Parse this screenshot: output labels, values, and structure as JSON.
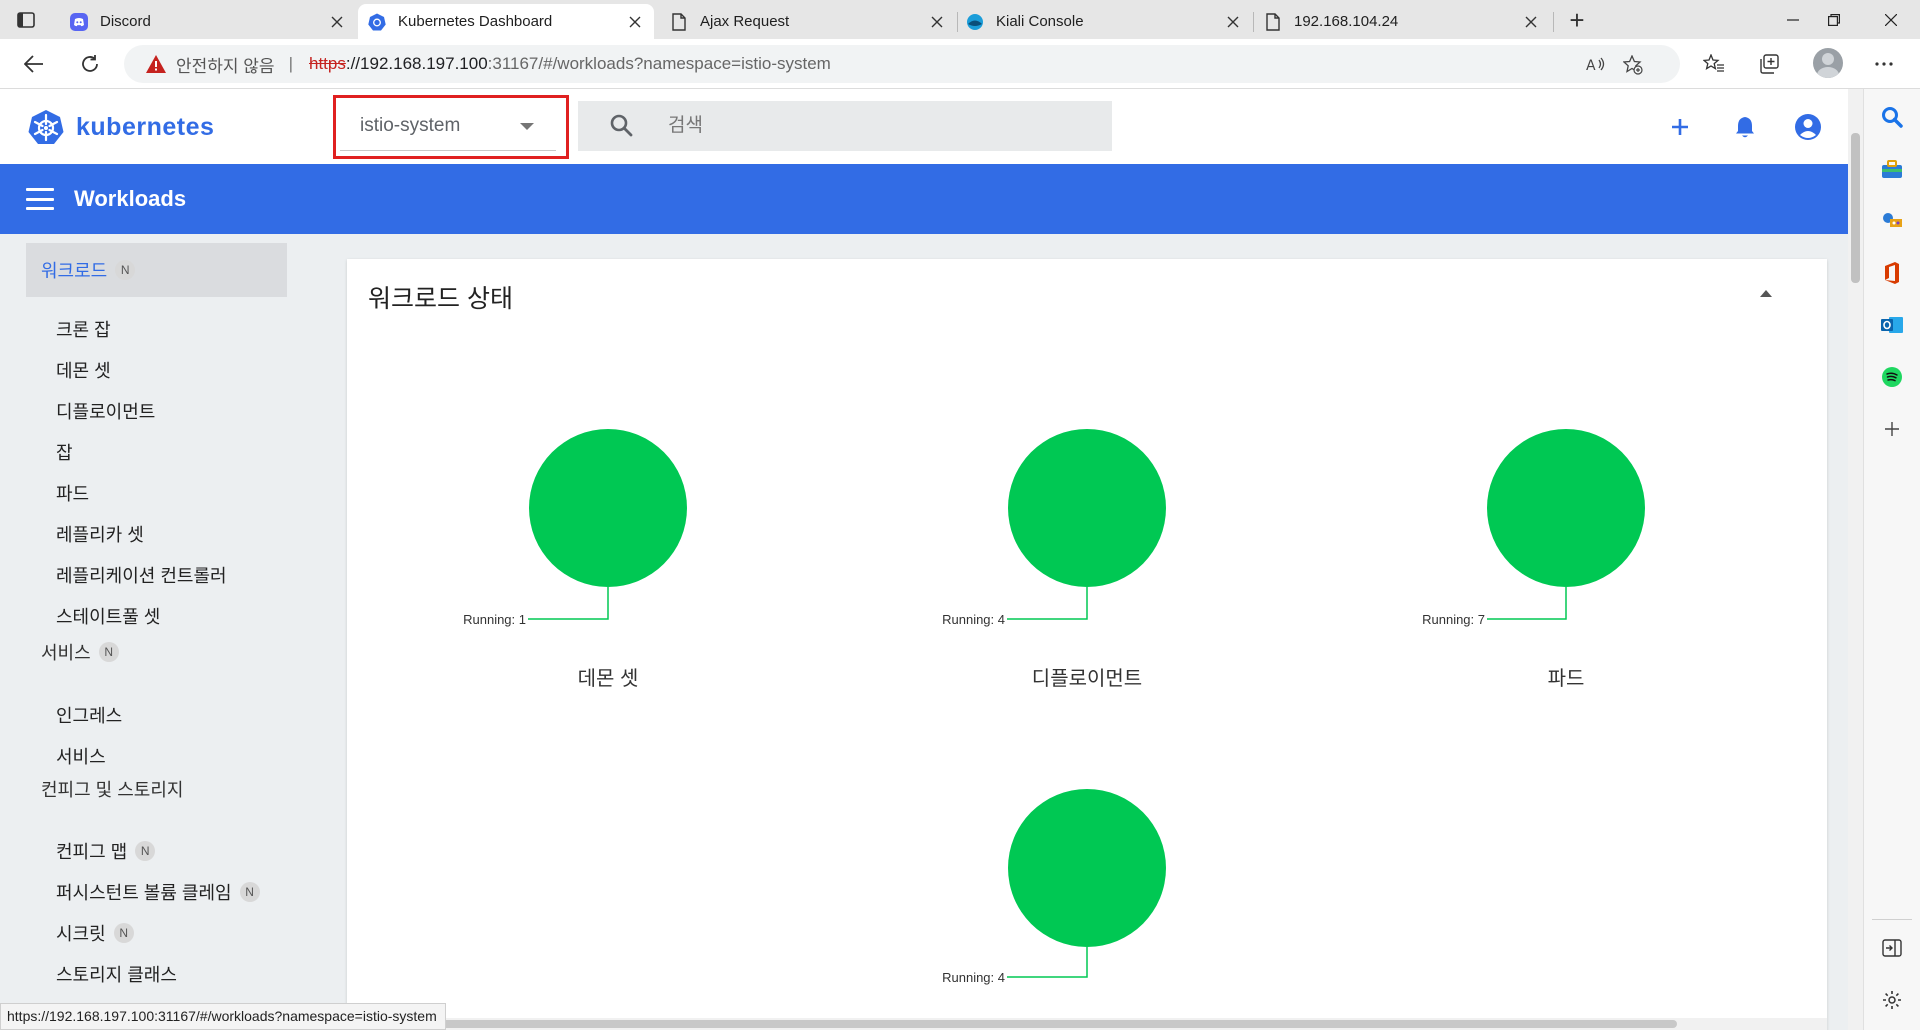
{
  "browser": {
    "tabs": [
      {
        "title": "Discord",
        "icon": "discord-icon",
        "active": false
      },
      {
        "title": "Kubernetes Dashboard",
        "icon": "kubernetes-icon",
        "active": true
      },
      {
        "title": "Ajax Request",
        "icon": "document-icon",
        "active": false
      },
      {
        "title": "Kiali Console",
        "icon": "kiali-icon",
        "active": false
      },
      {
        "title": "192.168.104.24",
        "icon": "document-icon",
        "active": false
      }
    ],
    "address": {
      "security_label": "안전하지 않음",
      "separator": "|",
      "url_scheme": "https",
      "url_host": "://192.168.197.100",
      "url_rest": ":31167/#/workloads?namespace=istio-system"
    },
    "status_url": "https://192.168.197.100:31167/#/workloads?namespace=istio-system",
    "colors": {
      "insecure": "#c5221f",
      "tabstrip": "#e6e6e6"
    }
  },
  "app": {
    "brand": "kubernetes",
    "brand_color": "#326ce5",
    "namespace": "istio-system",
    "search_placeholder": "검색",
    "toolbar_title": "Workloads"
  },
  "nav": {
    "badge": "N",
    "groups": [
      {
        "label": "워크로드",
        "badge": true,
        "selected": true,
        "items": [
          {
            "label": "크론 잡"
          },
          {
            "label": "데몬 셋"
          },
          {
            "label": "디플로이먼트"
          },
          {
            "label": "잡"
          },
          {
            "label": "파드"
          },
          {
            "label": "레플리카 셋"
          },
          {
            "label": "레플리케이션 컨트롤러"
          },
          {
            "label": "스테이트풀 셋"
          }
        ]
      },
      {
        "label": "서비스",
        "badge": true,
        "selected": false,
        "items": [
          {
            "label": "인그레스"
          },
          {
            "label": "서비스"
          }
        ]
      },
      {
        "label": "컨피그 및 스토리지",
        "badge": false,
        "selected": false,
        "items": [
          {
            "label": "컨피그 맵",
            "badge": true
          },
          {
            "label": "퍼시스턴트 볼륨 클레임",
            "badge": true
          },
          {
            "label": "시크릿",
            "badge": true
          },
          {
            "label": "스토리지 클래스"
          }
        ]
      }
    ]
  },
  "workload_status": {
    "title": "워크로드 상태",
    "running_color": "#00c853",
    "charts": [
      {
        "name": "데몬 셋",
        "label": "Running: 1",
        "running": 1
      },
      {
        "name": "디플로이먼트",
        "label": "Running: 4",
        "running": 4
      },
      {
        "name": "파드",
        "label": "Running: 7",
        "running": 7
      },
      {
        "name": "",
        "label": "Running: 4",
        "running": 4
      }
    ]
  }
}
